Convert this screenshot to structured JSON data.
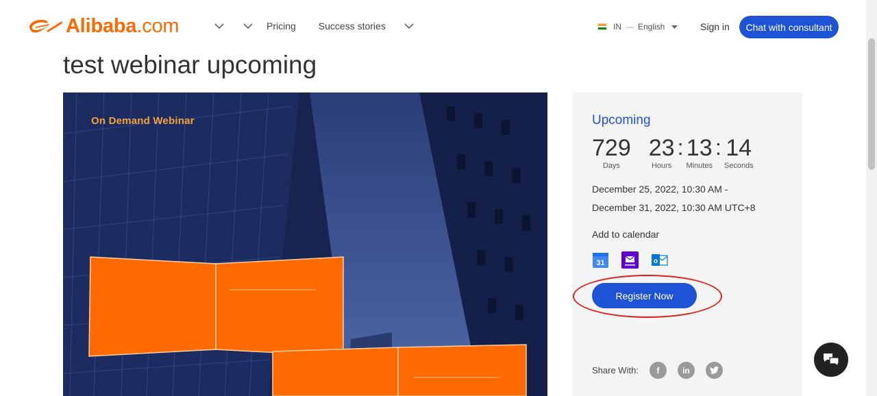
{
  "header": {
    "logo_text": "Alibaba",
    "logo_suffix": ".com",
    "nav": {
      "pricing": "Pricing",
      "success_stories": "Success stories"
    },
    "locale": {
      "country": "IN",
      "dash": "—",
      "language": "English"
    },
    "sign_in": "Sign in",
    "chat_button": "Chat with consultant"
  },
  "page": {
    "title": "test webinar upcoming"
  },
  "hero": {
    "label": "On Demand Webinar"
  },
  "event": {
    "status": "Upcoming",
    "countdown": {
      "days": "729",
      "days_label": "Days",
      "hours": "23",
      "hours_label": "Hours",
      "minutes": "13",
      "minutes_label": "Minutes",
      "seconds": "14",
      "seconds_label": "Seconds",
      "separator": ":"
    },
    "date_start": "December 25, 2022, 10:30 AM -",
    "date_end": "December 31, 2022, 10:30 AM UTC+8",
    "calendar_label": "Add to calendar",
    "calendar_icons": [
      "google-calendar-icon",
      "yahoo-calendar-icon",
      "outlook-calendar-icon"
    ],
    "register_button": "Register Now",
    "share_label": "Share With:",
    "share_icons": [
      "facebook-icon",
      "linkedin-icon",
      "twitter-icon"
    ]
  },
  "colors": {
    "brand_orange": "#ff6a00",
    "primary_blue": "#1d53d4",
    "highlight_red": "#e0201c",
    "panel_bg": "#f4f4f4"
  }
}
